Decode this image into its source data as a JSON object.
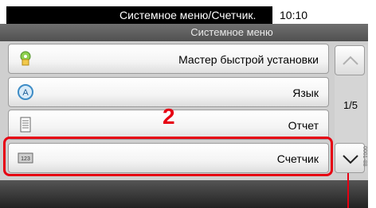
{
  "status": {
    "title": "Системное меню/Счетчик.",
    "time": "10:10"
  },
  "header": {
    "title": "Системное меню"
  },
  "menu": {
    "items": [
      {
        "label": "Мастер быстрой установки",
        "icon": "quick-setup-icon"
      },
      {
        "label": "Язык",
        "icon": "language-icon"
      },
      {
        "label": "Отчет",
        "icon": "report-icon"
      },
      {
        "label": "Счетчик",
        "icon": "counter-icon"
      }
    ]
  },
  "scroll": {
    "page": "1/5"
  },
  "annotation": {
    "step": "2",
    "color": "#e60012"
  },
  "side_code": "0001-88"
}
